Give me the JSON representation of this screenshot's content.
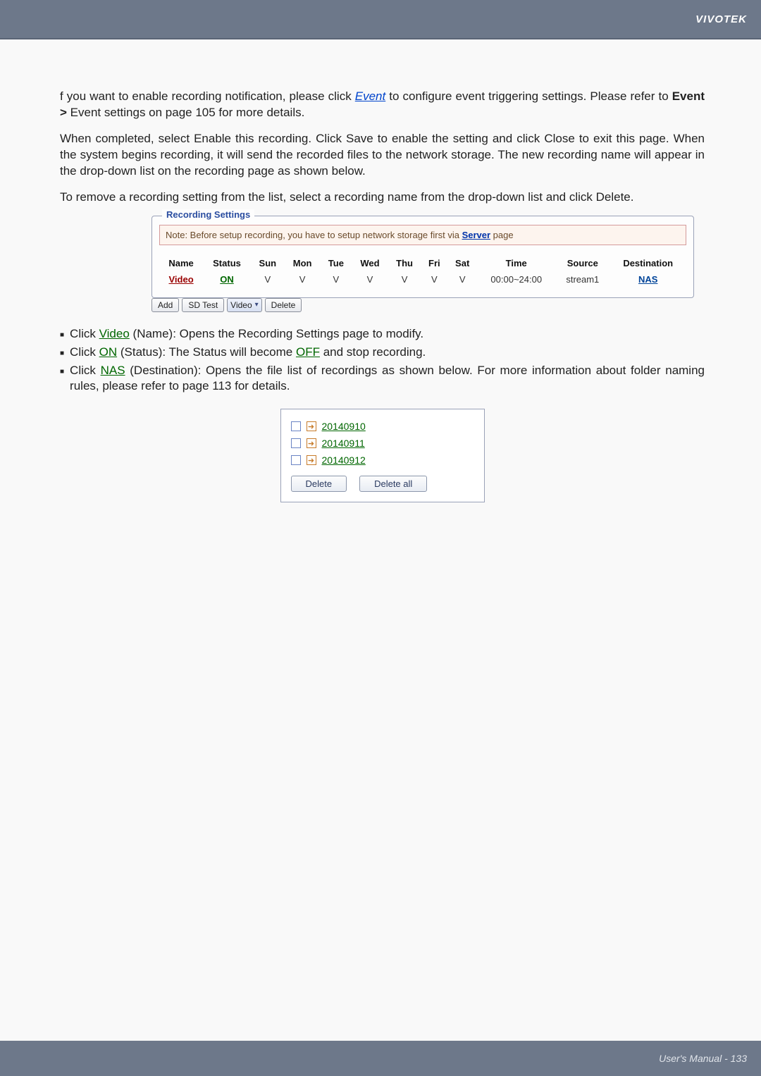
{
  "header": {
    "brand": "VIVOTEK"
  },
  "body": {
    "p1a": "f you want to enable recording notification, please click ",
    "p1_link": "Event",
    "p1b": " to configure event triggering settings. Please refer to ",
    "p1_bold": "Event >",
    "p1c": " Event settings on page 105 for more details.",
    "p2": "When completed, select Enable this recording. Click   Save to enable the setting and click Close to exit this page. When the system begins recording, it will send the recorded files to the network storage. The new recording name will appear in the drop-down list on the recording page as shown below.",
    "p3": "To remove a recording setting from the list, select a recording name from the drop-down list and click Delete."
  },
  "recbox": {
    "legend": "Recording Settings",
    "note_a": "Note: Before setup recording, you have to setup network storage first via ",
    "note_link": "Server",
    "note_b": " page",
    "headers": [
      "Name",
      "Status",
      "Sun",
      "Mon",
      "Tue",
      "Wed",
      "Thu",
      "Fri",
      "Sat",
      "Time",
      "Source",
      "Destination"
    ],
    "row": {
      "name": "Video",
      "status": "ON",
      "days": [
        "V",
        "V",
        "V",
        "V",
        "V",
        "V",
        "V"
      ],
      "time": "00:00~24:00",
      "source": "stream1",
      "dest": "NAS"
    }
  },
  "controls": {
    "add": "Add",
    "sdtest": "SD Test",
    "select": "Video",
    "delete": "Delete"
  },
  "bullets": {
    "b1a": "Click ",
    "b1_link": "Video",
    "b1b": " (Name): Opens the Recording Settings page to modify.",
    "b2a": "Click ",
    "b2_link": "ON",
    "b2b": " (Status): The Status will become ",
    "b2_link2": "OFF",
    "b2c": " and stop recording.",
    "b3a": "Click ",
    "b3_link": "NAS",
    "b3b": " (Destination): Opens the file list of recordings as shown below. For more information about folder naming rules, please refer to page 113 for details."
  },
  "filepanel": {
    "items": [
      "20140910",
      "20140911",
      "20140912"
    ],
    "delete": "Delete",
    "delete_all": "Delete all"
  },
  "footer": {
    "text": "User's Manual - 133"
  }
}
